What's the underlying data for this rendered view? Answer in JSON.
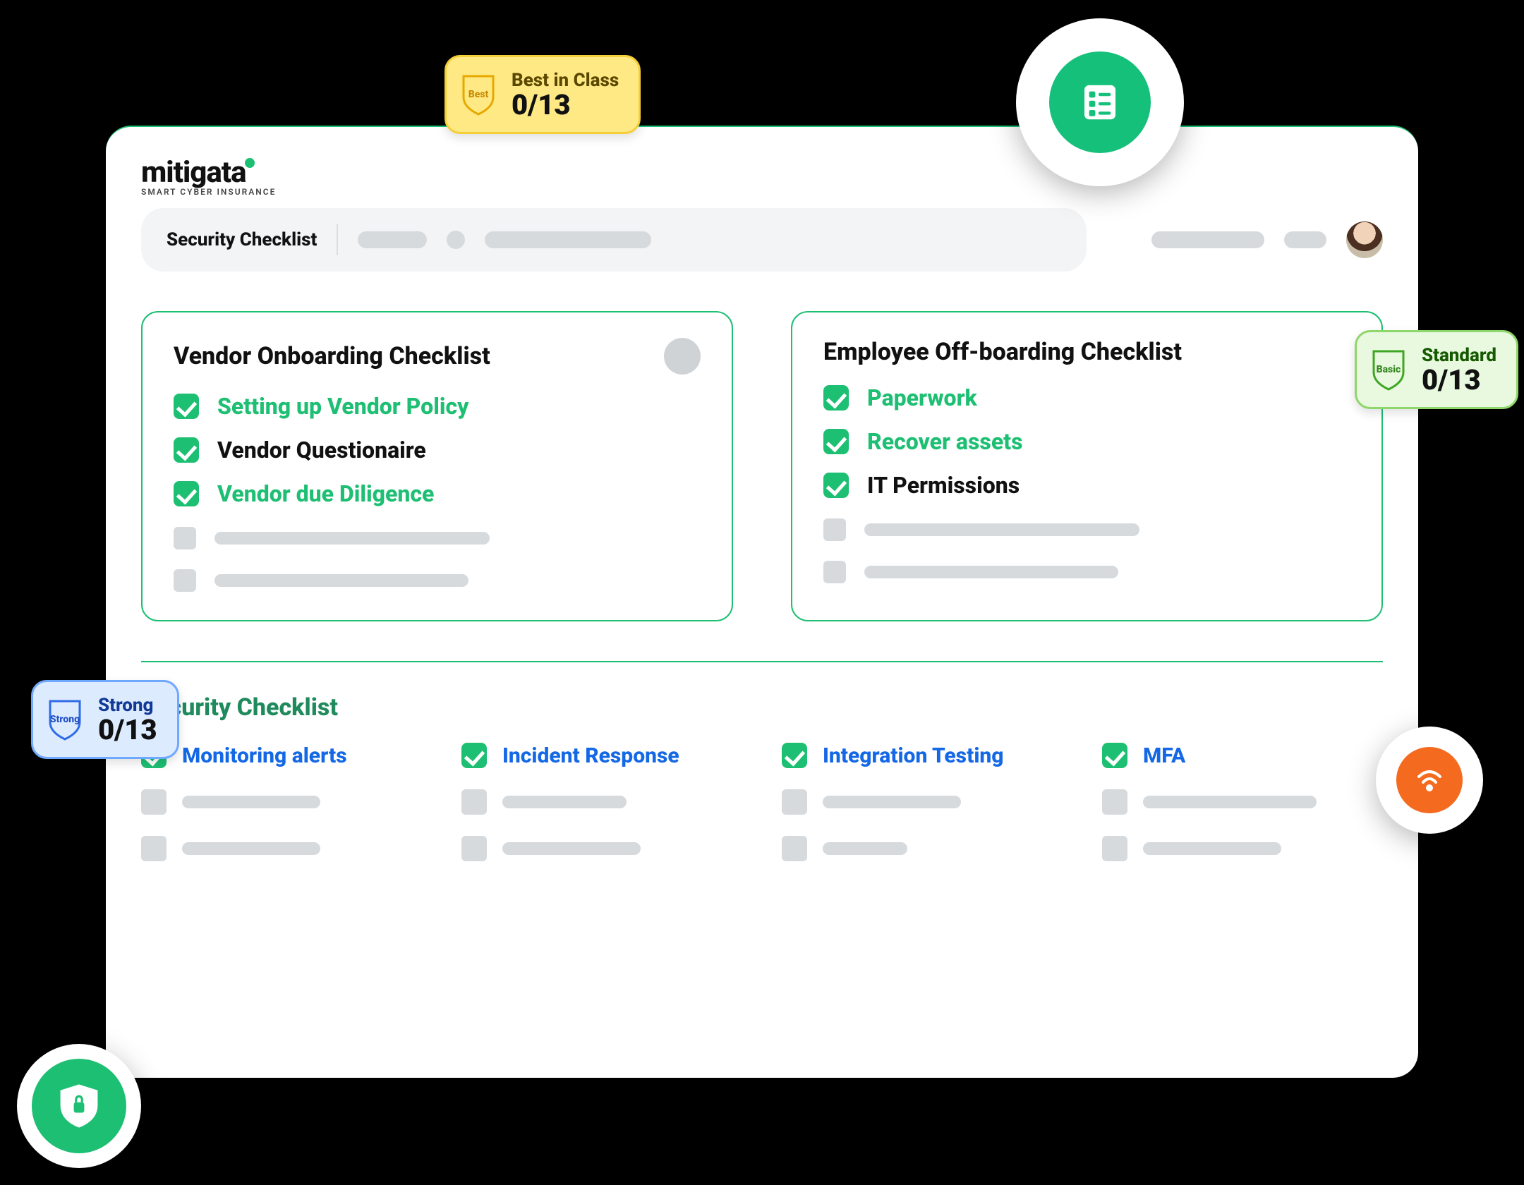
{
  "brand": {
    "name": "mitigata",
    "tagline": "SMART CYBER INSURANCE"
  },
  "topbar": {
    "title": "Security Checklist"
  },
  "cards": {
    "vendor": {
      "title": "Vendor Onboarding Checklist",
      "items": [
        "Setting up Vendor Policy",
        "Vendor Questionaire",
        "Vendor due Diligence"
      ]
    },
    "offboarding": {
      "title": "Employee Off-boarding Checklist",
      "items": [
        "Paperwork",
        "Recover assets",
        "IT Permissions"
      ]
    }
  },
  "securitySection": {
    "title": "Security Checklist",
    "items": [
      "Monitoring alerts",
      "Incident Response",
      "Integration Testing",
      "MFA"
    ]
  },
  "badges": {
    "best": {
      "shield": "Best",
      "label": "Best in Class",
      "count": "0/13"
    },
    "strong": {
      "shield": "Strong",
      "label": "Strong",
      "count": "0/13"
    },
    "standard": {
      "shield": "Basic",
      "label": "Standard",
      "count": "0/13"
    }
  },
  "colors": {
    "accent": "#1DBF73",
    "blue": "#1468E6",
    "orange": "#F46A1F"
  }
}
